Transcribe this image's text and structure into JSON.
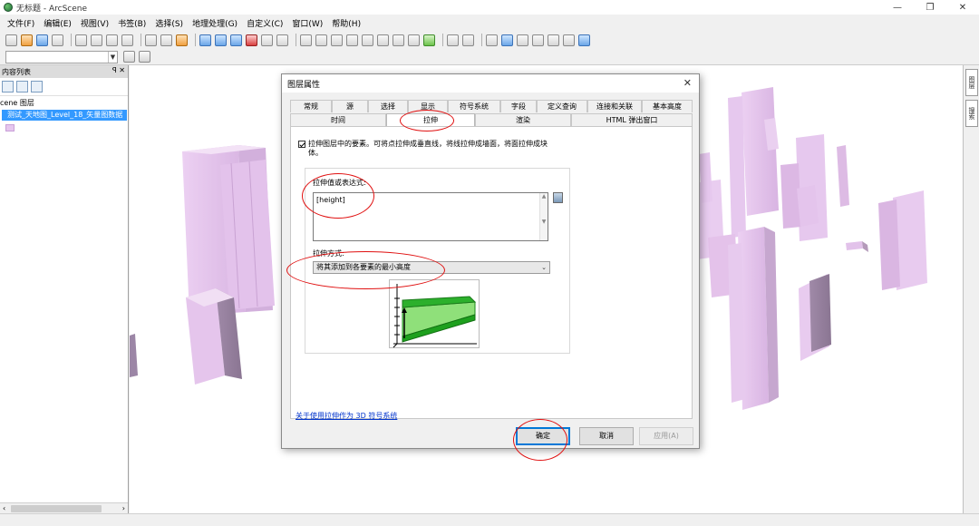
{
  "window": {
    "title": "无标题 - ArcScene"
  },
  "menu": [
    "文件(F)",
    "编辑(E)",
    "视图(V)",
    "书签(B)",
    "选择(S)",
    "地理处理(G)",
    "自定义(C)",
    "窗口(W)",
    "帮助(H)"
  ],
  "toc": {
    "title": "内容列表",
    "pin_close": "ꟼ ✕",
    "root": "cene 图层",
    "layer": "测试_天地图_Level_18_矢量图数据"
  },
  "right_dock": {
    "tab1": "图层",
    "tab2": "搜索"
  },
  "dialog": {
    "title": "图层属性",
    "close": "✕",
    "tabs_row1": [
      "常规",
      "源",
      "选择",
      "显示",
      "符号系统",
      "字段",
      "定义查询",
      "连接和关联",
      "基本高度"
    ],
    "tabs_row2": [
      "时间",
      "拉伸",
      "渲染",
      "HTML 弹出窗口"
    ],
    "extrude_checkbox": "拉伸图层中的要素。可将点拉伸成垂直线，将线拉伸成墙面，将面拉伸成块体。",
    "expr_label": "拉伸值或表达式:",
    "expr_value": "[height]",
    "mode_label": "拉伸方式:",
    "mode_value": "将其添加到各要素的最小高度",
    "help_link": "关于使用拉伸作为 3D 符号系统",
    "ok": "确定",
    "cancel": "取消",
    "apply": "应用(A)"
  },
  "colors": {
    "building": "#e6c6ee",
    "annotation": "#e01010",
    "selection": "#3399ff"
  }
}
